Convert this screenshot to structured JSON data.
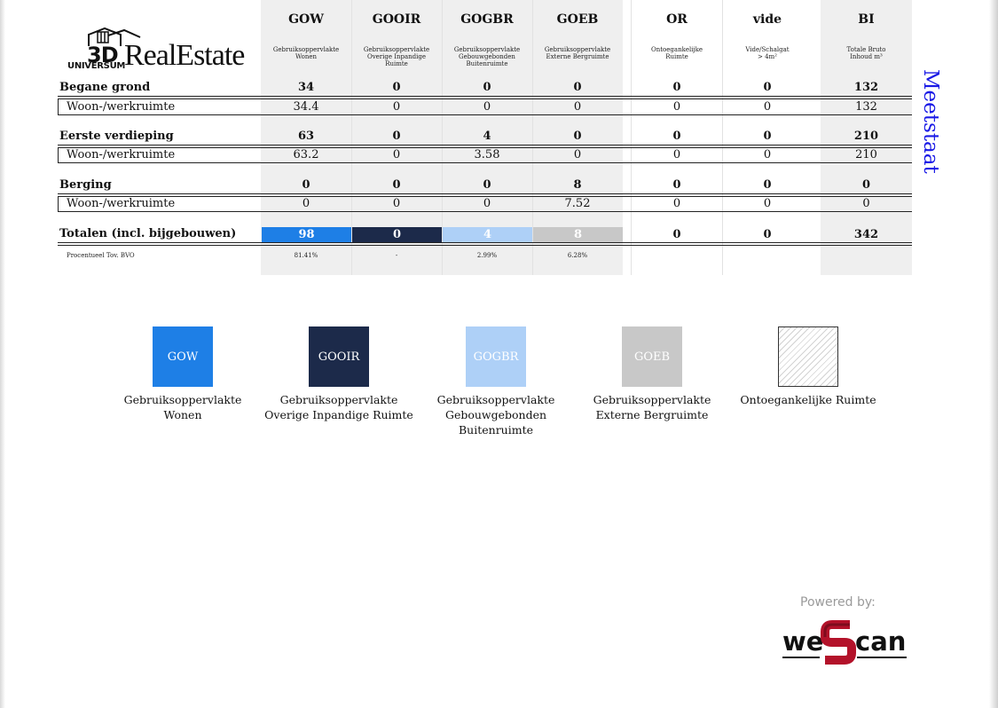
{
  "logo": {
    "three_d": "3D",
    "universum": "UNIVERSUM",
    "real_estate": "RealEstate"
  },
  "side_title": "Meetstaat",
  "columns": [
    {
      "code": "GOW",
      "desc": [
        "Gebruiksoppervlakte",
        "Wonen"
      ]
    },
    {
      "code": "GOOIR",
      "desc": [
        "Gebruiksoppervlakte",
        "Overige Inpandige",
        "Ruimte"
      ]
    },
    {
      "code": "GOGBR",
      "desc": [
        "Gebruiksoppervlakte",
        "Gebouwgebonden",
        "Buitenruimte"
      ]
    },
    {
      "code": "GOEB",
      "desc": [
        "Gebruiksoppervlakte",
        "Externe Bergruimte"
      ]
    },
    {
      "code": "OR",
      "desc": [
        "Ontoegankelijke",
        "Ruimte"
      ]
    },
    {
      "code": "vide",
      "desc": [
        "Vide/Schalgat",
        "> 4m²"
      ]
    },
    {
      "code": "BI",
      "desc": [
        "Totale Bruto",
        "Inhoud m³"
      ]
    }
  ],
  "sections": [
    {
      "title": "Begane grond",
      "totals": [
        "34",
        "0",
        "0",
        "0",
        "0",
        "0",
        "132"
      ],
      "sub_label": "Woon-/werkruimte",
      "sub_values": [
        "34.4",
        "0",
        "0",
        "0",
        "0",
        "0",
        "132"
      ]
    },
    {
      "title": "Eerste verdieping",
      "totals": [
        "63",
        "0",
        "4",
        "0",
        "0",
        "0",
        "210"
      ],
      "sub_label": "Woon-/werkruimte",
      "sub_values": [
        "63.2",
        "0",
        "3.58",
        "0",
        "0",
        "0",
        "210"
      ]
    },
    {
      "title": "Berging",
      "totals": [
        "0",
        "0",
        "0",
        "8",
        "0",
        "0",
        "0"
      ],
      "sub_label": "Woon-/werkruimte",
      "sub_values": [
        "0",
        "0",
        "0",
        "7.52",
        "0",
        "0",
        "0"
      ]
    }
  ],
  "totals_row": {
    "label": "Totalen (incl. bijgebouwen)",
    "values": [
      "98",
      "0",
      "4",
      "8",
      "0",
      "0",
      "342"
    ]
  },
  "percent_row": {
    "label": "Procentueel Tov. BVO",
    "values": [
      "81.41%",
      "-",
      "2.99%",
      "6.28%",
      "",
      "",
      ""
    ]
  },
  "colors": {
    "GOW": "#1e7fe6",
    "GOOIR": "#1c2a4a",
    "GOGBR": "#aed0f7",
    "GOEB": "#c8c8c8",
    "side_title": "#1a1ae6"
  },
  "legend": [
    {
      "code": "GOW",
      "lines": [
        "Gebruiksoppervlakte",
        "Wonen"
      ]
    },
    {
      "code": "GOOIR",
      "lines": [
        "Gebruiksoppervlakte",
        "Overige Inpandige Ruimte"
      ]
    },
    {
      "code": "GOGBR",
      "lines": [
        "Gebruiksoppervlakte",
        "Gebouwgebonden",
        "Buitenruimte"
      ]
    },
    {
      "code": "GOEB",
      "lines": [
        "Gebruiksoppervlakte",
        "Externe Bergruimte"
      ]
    },
    {
      "code": "",
      "lines": [
        "Ontoegankelijke Ruimte"
      ]
    }
  ],
  "footer": {
    "powered_by": "Powered by:",
    "brand_we": "we",
    "brand_can": "can"
  }
}
